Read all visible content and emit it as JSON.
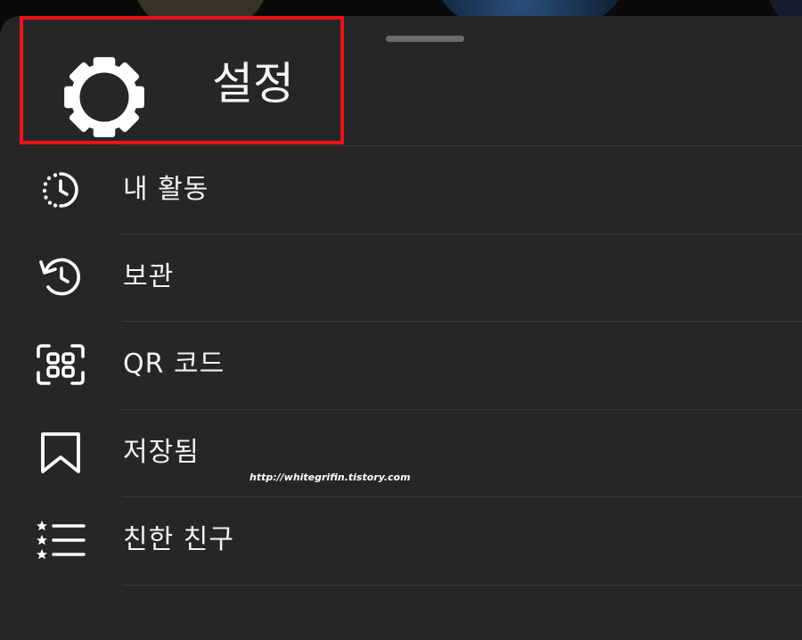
{
  "settings": {
    "label": "설정"
  },
  "menu": {
    "items": [
      {
        "label": "내 활동",
        "icon": "activity-clock-icon"
      },
      {
        "label": "보관",
        "icon": "archive-history-icon"
      },
      {
        "label": "QR 코드",
        "icon": "qr-scan-icon"
      },
      {
        "label": "저장됨",
        "icon": "bookmark-icon"
      },
      {
        "label": "친한 친구",
        "icon": "close-friends-list-icon"
      }
    ]
  },
  "watermark": "http://whitegrifin.tistory.com",
  "colors": {
    "sheet_background": "#262626",
    "highlight_border": "#e8141a",
    "text": "#f2f2f2",
    "divider": "#3a3a3a"
  }
}
